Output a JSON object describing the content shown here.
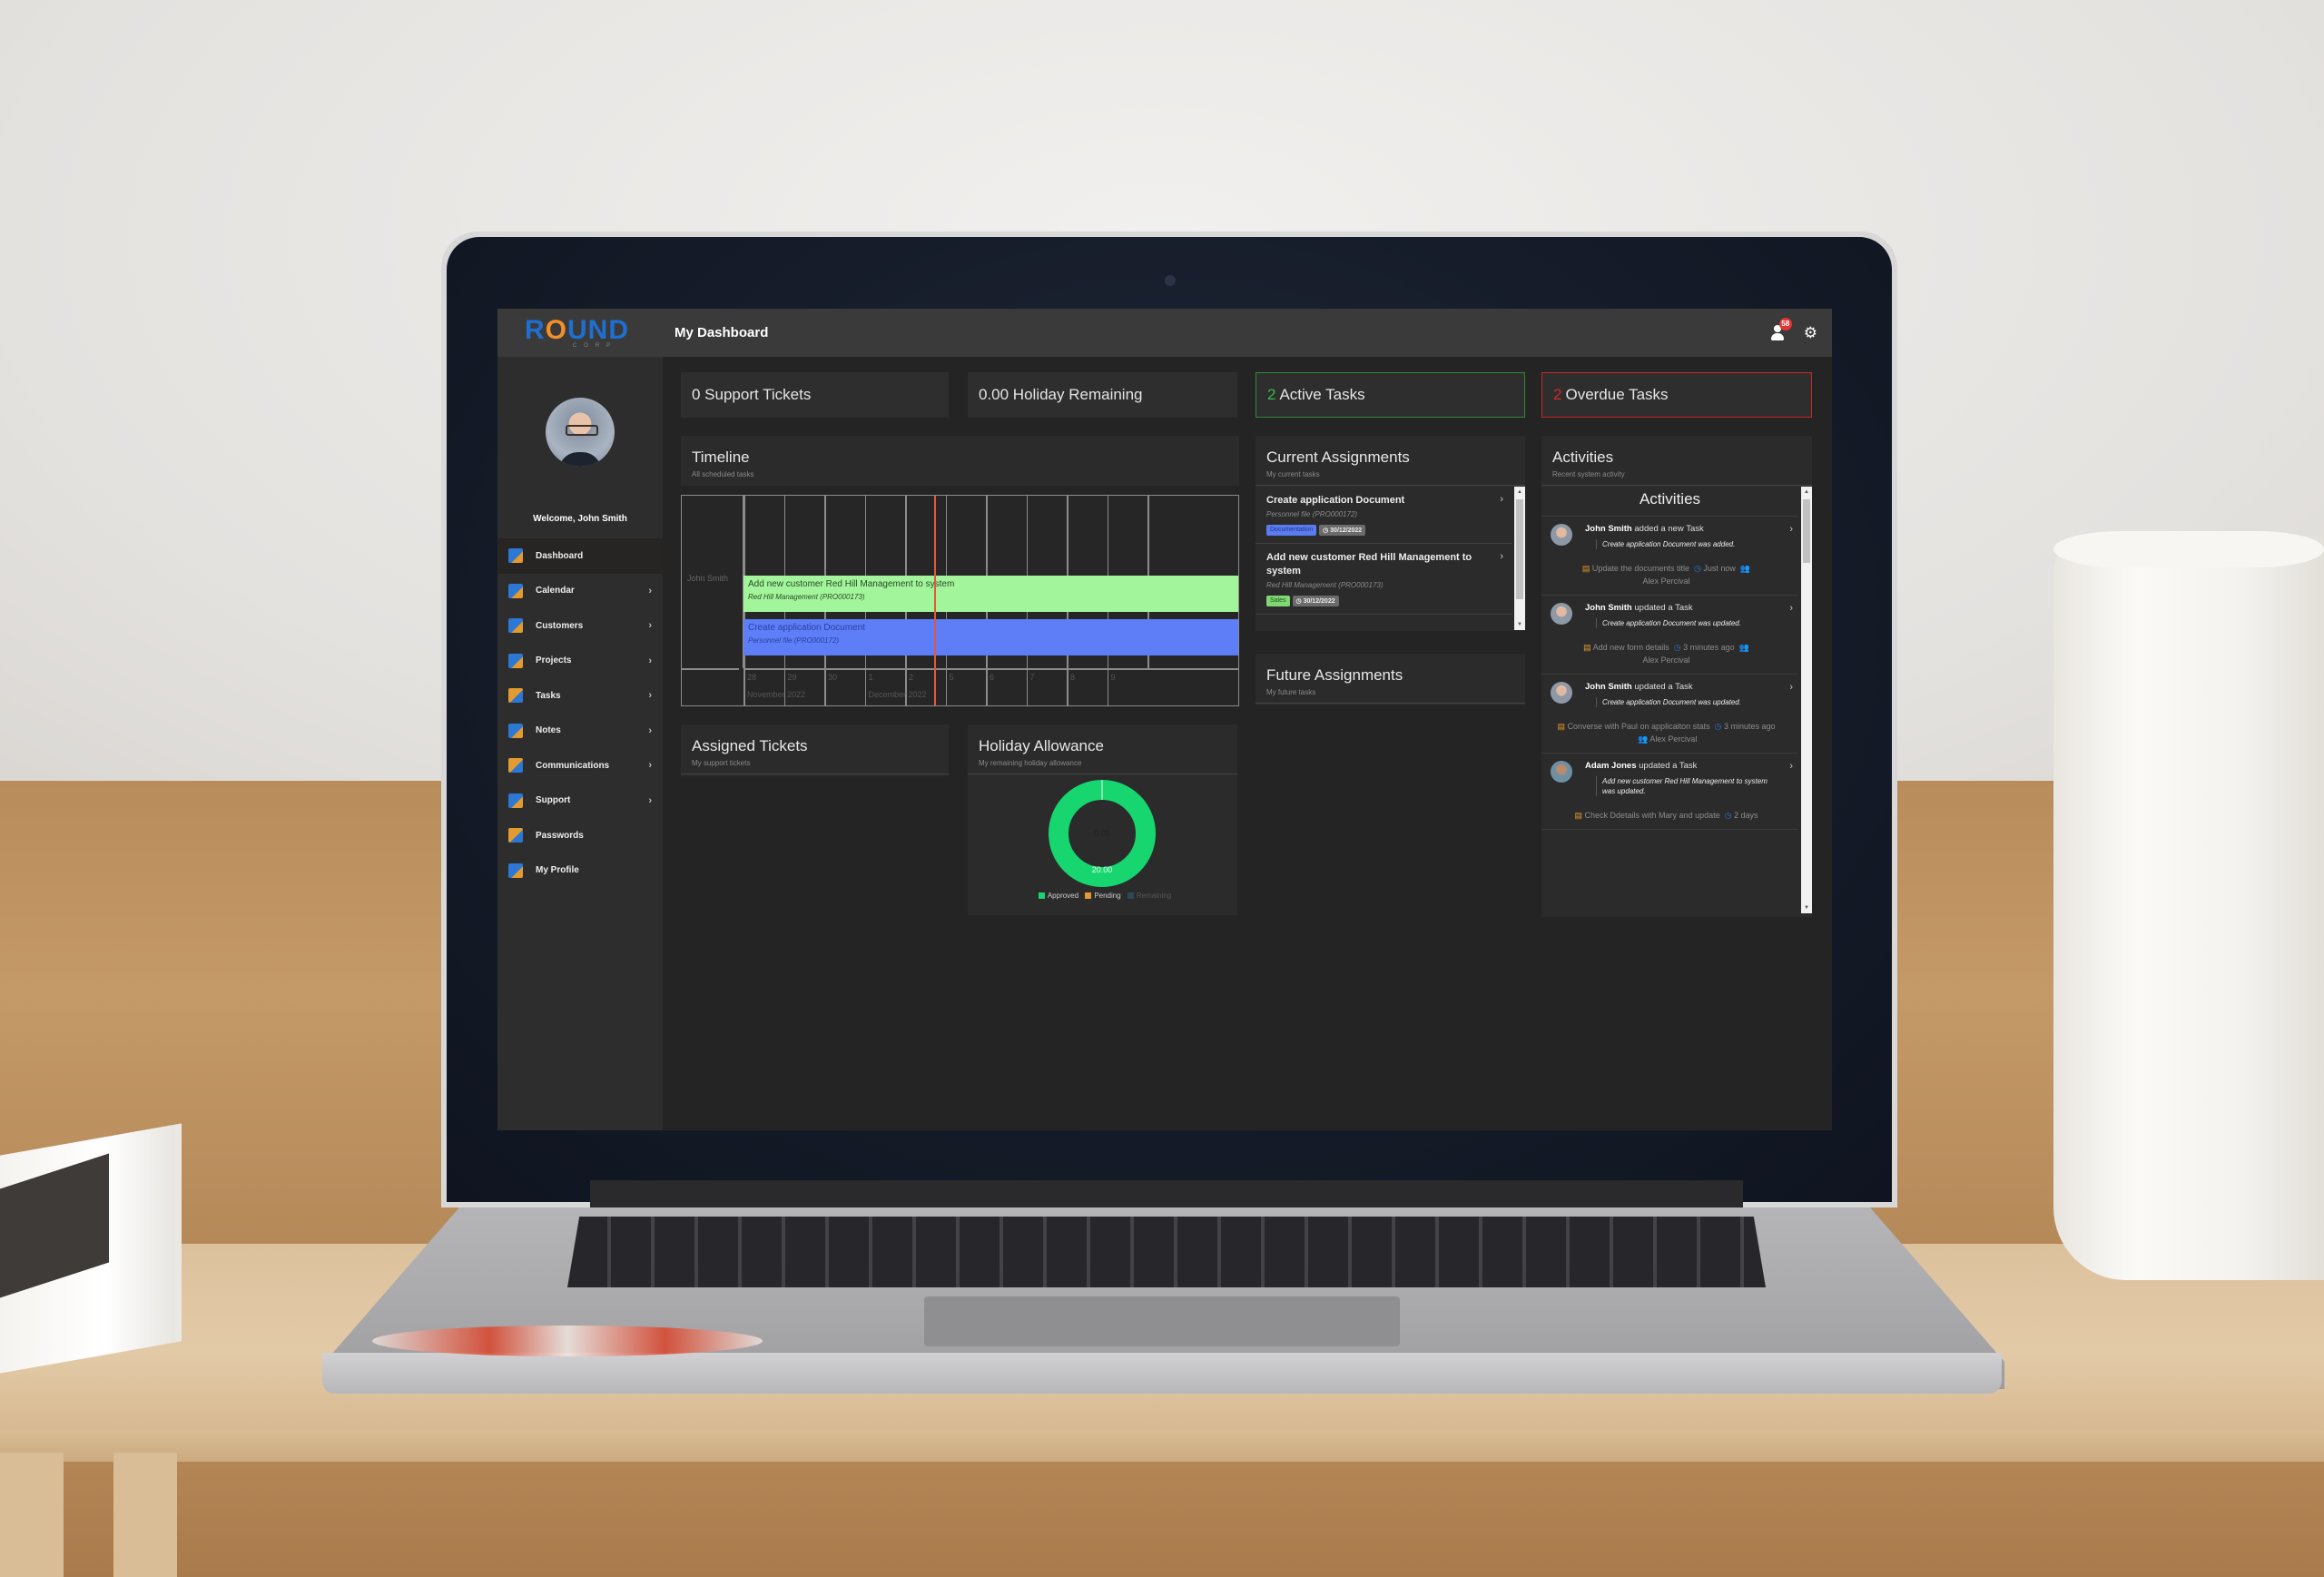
{
  "app": {
    "logo_text": "ROUND",
    "logo_sub": "CORP",
    "page_title": "My Dashboard",
    "notification_count": "58",
    "icons": {
      "notifications": "user-icon",
      "settings": "gear-icon"
    }
  },
  "sidebar": {
    "welcome": "Welcome, John Smith",
    "items": [
      {
        "label": "Dashboard",
        "icon": "dashboard-icon",
        "active": true,
        "has_children": false
      },
      {
        "label": "Calendar",
        "icon": "calendar-icon",
        "active": false,
        "has_children": true
      },
      {
        "label": "Customers",
        "icon": "customers-icon",
        "active": false,
        "has_children": true
      },
      {
        "label": "Projects",
        "icon": "projects-icon",
        "active": false,
        "has_children": true
      },
      {
        "label": "Tasks",
        "icon": "tasks-icon",
        "active": false,
        "has_children": true
      },
      {
        "label": "Notes",
        "icon": "notes-icon",
        "active": false,
        "has_children": true
      },
      {
        "label": "Communications",
        "icon": "communications-icon",
        "active": false,
        "has_children": true
      },
      {
        "label": "Support",
        "icon": "support-icon",
        "active": false,
        "has_children": true
      },
      {
        "label": "Passwords",
        "icon": "passwords-icon",
        "active": false,
        "has_children": false
      },
      {
        "label": "My Profile",
        "icon": "profile-icon",
        "active": false,
        "has_children": false
      }
    ]
  },
  "stats": {
    "support_tickets": "0 Support Tickets",
    "holiday_remaining": "0.00 Holiday Remaining",
    "active_count": "2",
    "active_label": "Active Tasks",
    "overdue_count": "2",
    "overdue_label": "Overdue Tasks"
  },
  "timeline": {
    "title": "Timeline",
    "subtitle": "All scheduled tasks",
    "row_label": "John Smith",
    "days": [
      "28",
      "29",
      "30",
      "1",
      "2",
      "5",
      "6",
      "7",
      "8",
      "9"
    ],
    "months": [
      "November 2022",
      "December 2022"
    ],
    "tasks": [
      {
        "title": "Add new customer Red Hill Management to system",
        "project": "Red Hill Management (PRO000173)"
      },
      {
        "title": "Create application Document",
        "project": "Personnel file (PRO000172)"
      }
    ]
  },
  "current_assignments": {
    "title": "Current Assignments",
    "subtitle": "My current tasks",
    "items": [
      {
        "title": "Create application Document",
        "project": "Personnel file (PRO000172)",
        "tag": "Documentation",
        "due": "30/12/2022"
      },
      {
        "title": "Add new customer Red Hill Management to system",
        "project": "Red Hill Management (PRO000173)",
        "tag": "Sales",
        "due": "30/12/2022"
      }
    ]
  },
  "future_assignments": {
    "title": "Future Assignments",
    "subtitle": "My future tasks"
  },
  "assigned_tickets": {
    "title": "Assigned Tickets",
    "subtitle": "My support tickets"
  },
  "holiday_allowance": {
    "title": "Holiday Allowance",
    "subtitle": "My remaining holiday allowance",
    "center_value": "0.00",
    "approved_value": "20.00",
    "legend": [
      "Approved",
      "Pending",
      "Remaining"
    ],
    "colors": {
      "approved": "#17d66f",
      "pending": "#e39a2e",
      "remaining": "#2a4a5a"
    }
  },
  "activities": {
    "title": "Activities",
    "subtitle": "Recent system activity",
    "heading": "Activities",
    "items": [
      {
        "actor": "John Smith",
        "action": "added a new Task",
        "desc": "Create application Document was added.",
        "task": "Update the documents title",
        "time": "Just now",
        "assignee": "Alex Percival"
      },
      {
        "actor": "John Smith",
        "action": "updated a Task",
        "desc": "Create application Document was updated.",
        "task": "Add new form details",
        "time": "3 minutes ago",
        "assignee": "Alex Percival"
      },
      {
        "actor": "John Smith",
        "action": "updated a Task",
        "desc": "Create application Document was updated.",
        "task": "Converse with Paul on applicaiton stats",
        "time": "3 minutes ago",
        "assignee": "Alex Percival"
      },
      {
        "actor": "Adam Jones",
        "action": "updated a Task",
        "desc": "Add new customer Red Hill Management to system was updated.",
        "task": "Check Ddetails with Mary and update",
        "time": "2 days",
        "assignee": ""
      }
    ]
  }
}
